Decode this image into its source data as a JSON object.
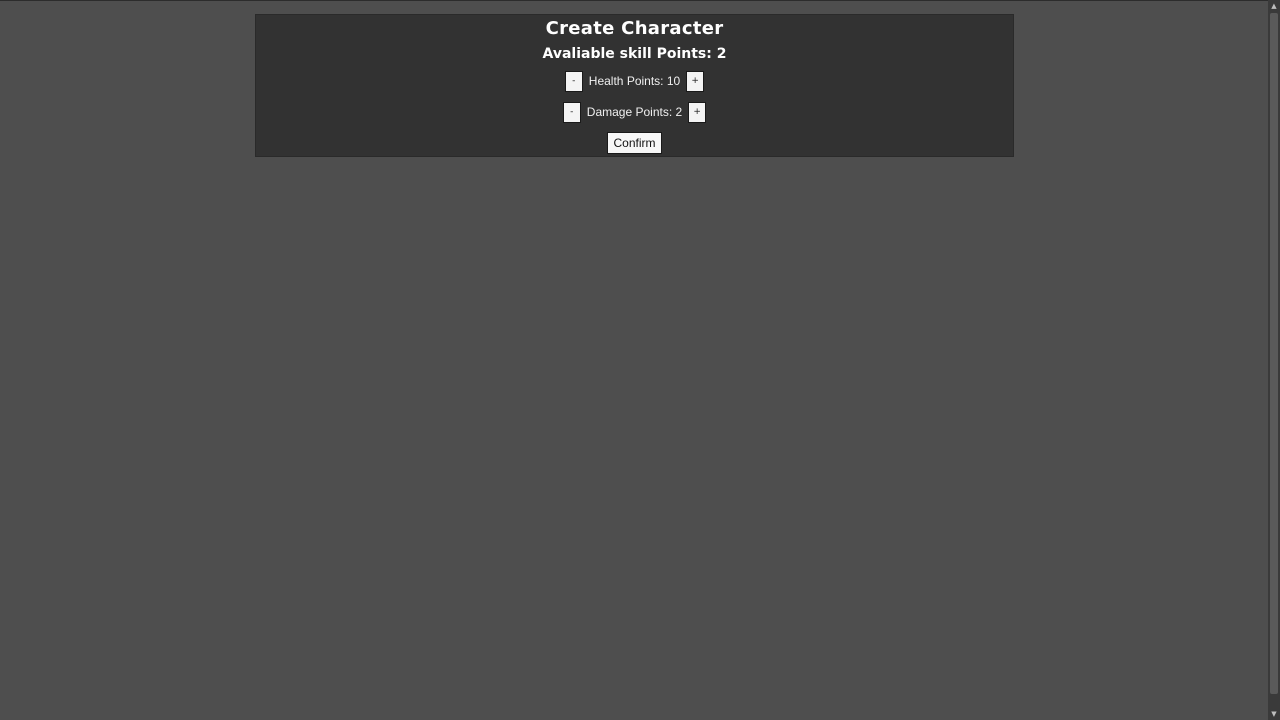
{
  "panel": {
    "title": "Create Character",
    "skill_points_text": "Avaliable skill Points: 2"
  },
  "stats": {
    "health": {
      "label": "Health Points: 10",
      "decrement_label": "-",
      "increment_label": "+"
    },
    "damage": {
      "label": "Damage Points: 2",
      "decrement_label": "-",
      "increment_label": "+"
    }
  },
  "actions": {
    "confirm_label": "Confirm"
  },
  "scrollbar": {
    "up_icon": "▲",
    "down_icon": "▼"
  },
  "colors": {
    "background": "#4e4e4e",
    "panel": "#323232",
    "text": "#ffffff"
  }
}
